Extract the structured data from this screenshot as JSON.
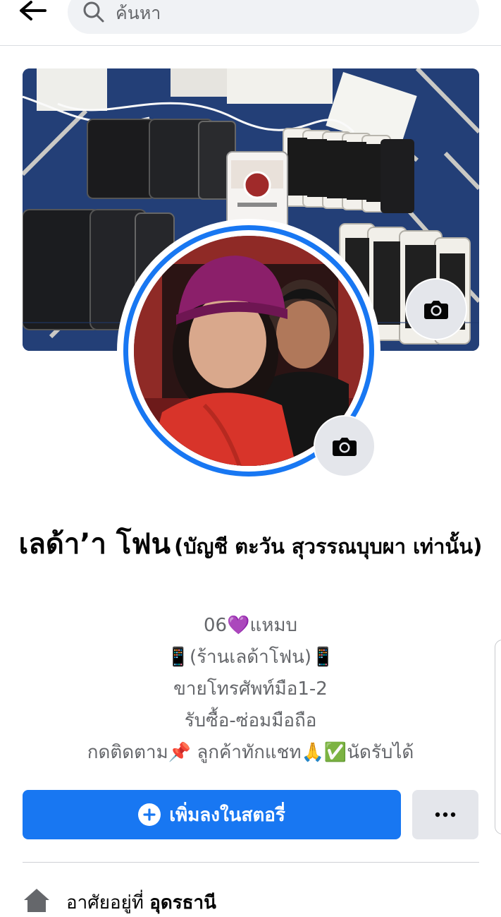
{
  "search": {
    "placeholder": "ค้นหา"
  },
  "profile": {
    "name": "เลด้า’า โฟน",
    "alternate_name": "(บัญชี ตะวัน สุวรรณบุบผา เท่านั้น)",
    "bio_lines": [
      "06💜แหมบ",
      "📱(ร้านเลด้าโฟน)📱",
      "ขายโทรศัพท์มือ1-2",
      "รับซื้อ-ซ่อมมือถือ",
      "กดติดตาม📌 ลูกค้าทักแชท🙏✅นัดรับได้"
    ]
  },
  "actions": {
    "add_story_label": "เพิ่มลงในสตอรี่"
  },
  "intro": {
    "lives_in_prefix": "อาศัยอยู่ที่",
    "lives_in_place": "อุดรธานี"
  },
  "colors": {
    "accent": "#1877f2",
    "secondary_button": "#e4e6eb",
    "muted_text": "#65676b"
  },
  "icons": {
    "back": "arrow-left-icon",
    "search": "magnifier-icon",
    "camera": "camera-icon",
    "add": "plus-circle-icon",
    "more": "ellipsis-icon",
    "home": "home-icon"
  }
}
